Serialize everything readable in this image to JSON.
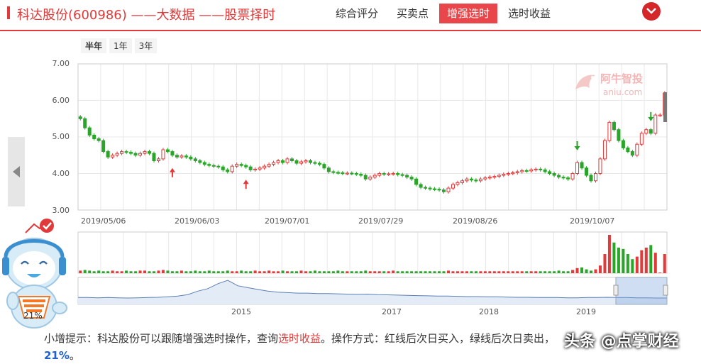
{
  "header": {
    "title": "科达股份(600986) ——大数据 ——股票择时",
    "tabs": [
      {
        "label": "综合评分",
        "active": false
      },
      {
        "label": "买卖点",
        "active": false
      },
      {
        "label": "增强选时",
        "active": true
      },
      {
        "label": "选时收益",
        "active": false
      }
    ],
    "accent_color": "#e03a3a"
  },
  "periods": [
    "半年",
    "1年",
    "3年"
  ],
  "selected_period": "半年",
  "watermark": {
    "name": "阿牛智投",
    "url": "aniu.com"
  },
  "mascot": {
    "percent": "21%"
  },
  "tip": {
    "prefix": "小增提示：科达股份可以跟随增强选时操作，查询",
    "link": "选时收益",
    "middle": "。操作方式：红线后次日买入，绿线后次日卖",
    "tail": "出，",
    "value": "21%",
    "end": "。"
  },
  "bottom_watermark": "头条 @点掌财经",
  "chart_data": {
    "type": "candlestick",
    "ylim": [
      3.0,
      7.0
    ],
    "yticks": [
      "7.00",
      "6.00",
      "5.00",
      "4.00",
      "3.00"
    ],
    "xticks": [
      "2019/05/06",
      "2019/06/03",
      "2019/07/01",
      "2019/07/29",
      "2019/08/26",
      "2019/10/07"
    ],
    "overview_labels": [
      "2015",
      "2017",
      "2018",
      "2019"
    ],
    "closes": [
      5.5,
      5.25,
      5.05,
      4.95,
      4.9,
      4.6,
      4.45,
      4.5,
      4.55,
      4.6,
      4.58,
      4.55,
      4.5,
      4.55,
      4.6,
      4.55,
      4.35,
      4.4,
      4.65,
      4.6,
      4.5,
      4.45,
      4.48,
      4.45,
      4.4,
      4.35,
      4.3,
      4.25,
      4.22,
      4.2,
      4.18,
      4.1,
      4.05,
      4.2,
      4.25,
      4.22,
      4.18,
      4.1,
      4.12,
      4.15,
      4.2,
      4.25,
      4.3,
      4.35,
      4.3,
      4.4,
      4.35,
      4.28,
      4.32,
      4.35,
      4.3,
      4.28,
      4.25,
      4.15,
      4.05,
      4.03,
      4.02,
      4.0,
      4.01,
      4.0,
      3.98,
      3.95,
      3.85,
      3.9,
      3.95,
      4.0,
      3.98,
      3.99,
      4.0,
      3.97,
      3.95,
      3.9,
      3.85,
      3.7,
      3.62,
      3.6,
      3.58,
      3.57,
      3.55,
      3.5,
      3.6,
      3.7,
      3.75,
      3.8,
      3.85,
      3.82,
      3.8,
      3.85,
      3.88,
      3.9,
      3.92,
      3.95,
      3.98,
      4.0,
      4.02,
      4.05,
      4.08,
      4.07,
      4.1,
      4.12,
      4.1,
      4.05,
      4.0,
      3.95,
      3.9,
      3.88,
      3.85,
      4.0,
      4.3,
      4.15,
      3.95,
      3.8,
      4.0,
      4.4,
      4.9,
      5.4,
      5.2,
      4.9,
      4.7,
      4.6,
      4.5,
      4.8,
      5.1,
      5.2,
      5.1,
      5.6,
      5.6,
      6.2
    ],
    "volumes": [
      4,
      5,
      4,
      3,
      4,
      3,
      3,
      4,
      3,
      3,
      4,
      3,
      3,
      4,
      4,
      3,
      3,
      4,
      5,
      4,
      3,
      3,
      4,
      3,
      3,
      4,
      3,
      3,
      4,
      3,
      3,
      3,
      4,
      3,
      3,
      4,
      3,
      3,
      4,
      3,
      3,
      4,
      3,
      3,
      4,
      3,
      3,
      3,
      4,
      3,
      3,
      4,
      3,
      3,
      3,
      3,
      4,
      3,
      3,
      3,
      3,
      3,
      4,
      3,
      3,
      3,
      3,
      3,
      4,
      3,
      3,
      3,
      3,
      3,
      3,
      3,
      3,
      3,
      3,
      3,
      4,
      3,
      3,
      3,
      3,
      3,
      3,
      3,
      3,
      3,
      3,
      3,
      3,
      3,
      3,
      3,
      3,
      3,
      3,
      3,
      3,
      3,
      3,
      3,
      4,
      3,
      3,
      5,
      8,
      9,
      6,
      4,
      6,
      12,
      30,
      60,
      48,
      40,
      38,
      30,
      22,
      26,
      36,
      40,
      44,
      32,
      1,
      30
    ],
    "overview_series": [
      22,
      22,
      21,
      22,
      21,
      20,
      21,
      22,
      23,
      25,
      28,
      34,
      48,
      58,
      78,
      92,
      70,
      62,
      55,
      48,
      44,
      42,
      40,
      40,
      38,
      38,
      37,
      36,
      35,
      36,
      34,
      33,
      32,
      31,
      30,
      29,
      28,
      28,
      27,
      26,
      26,
      25,
      25,
      24,
      23,
      23,
      22,
      22,
      22,
      21,
      21,
      22,
      22,
      23,
      22,
      22,
      21,
      21,
      20,
      20
    ],
    "signals": [
      {
        "type": "buy",
        "index": 20
      },
      {
        "type": "buy",
        "index": 36
      },
      {
        "type": "sell",
        "index": 108
      },
      {
        "type": "sell",
        "index": 124
      }
    ],
    "colors": {
      "up": "#e03a3a",
      "down": "#2aa52a",
      "grid": "#e8e8e8",
      "overview": "#5b7fb5"
    }
  }
}
